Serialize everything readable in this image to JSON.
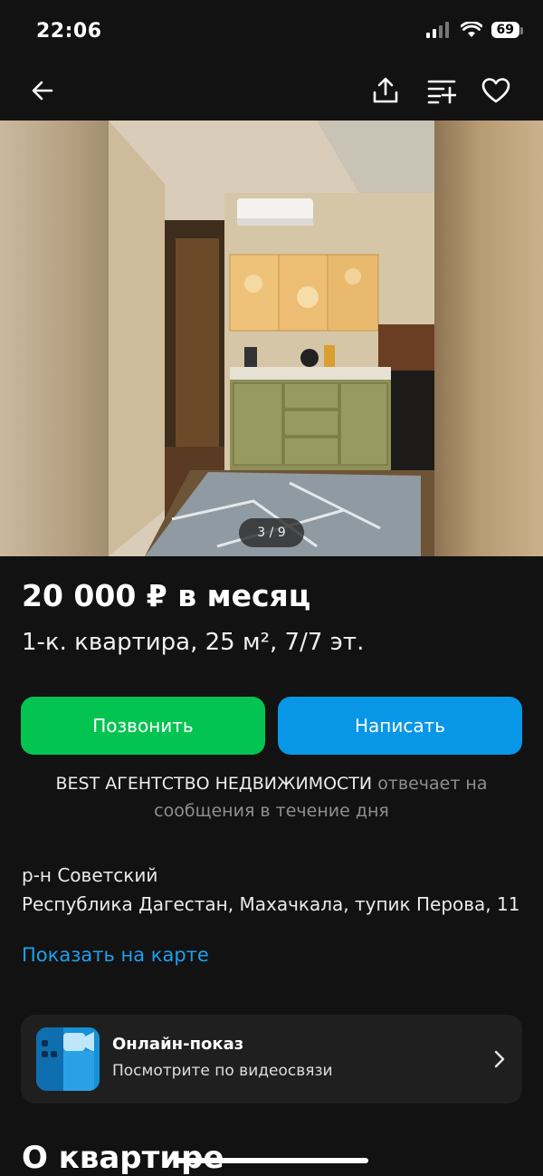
{
  "status": {
    "time": "22:06",
    "battery": "69"
  },
  "toolbar": {
    "back_icon": "arrow-left-icon",
    "share_icon": "share-icon",
    "compare_icon": "compare-list-icon",
    "favorite_icon": "heart-icon"
  },
  "gallery": {
    "counter": "3 / 9"
  },
  "listing": {
    "price": "20 000 ₽ в месяц",
    "subtitle": "1-к. квартира, 25 м², 7/7 эт."
  },
  "actions": {
    "call_label": "Позвонить",
    "write_label": "Написать"
  },
  "agency": {
    "name": "BEST АГЕНТСТВО НЕДВИЖИМОСТИ",
    "reply_note": "отвечает на сообщения в течение дня"
  },
  "address": {
    "district": "р-н Советский",
    "full": "Республика Дагестан, Махачкала, тупик Перова, 11",
    "map_link": "Показать на карте"
  },
  "online_show": {
    "title": "Онлайн-показ",
    "subtitle": "Посмотрите по видеосвязи"
  },
  "section": {
    "about_title": "О квартире"
  },
  "colors": {
    "call": "#04c451",
    "write": "#0897e6",
    "link": "#1f9fee",
    "background": "#121212"
  }
}
